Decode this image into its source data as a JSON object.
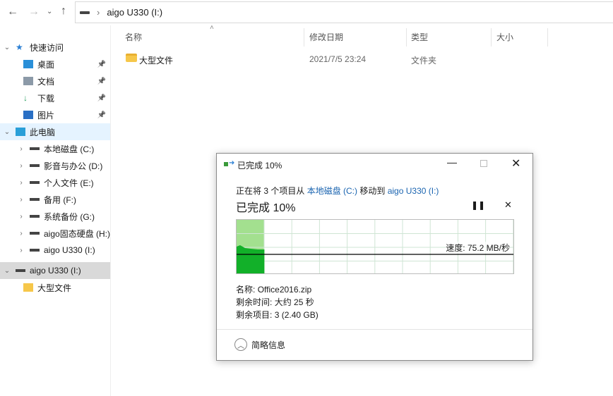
{
  "address": {
    "path": "aigo U330 (I:)"
  },
  "sidebar": {
    "items": [
      {
        "label": "快速访问",
        "icon": "star-icon"
      },
      {
        "label": "桌面",
        "icon": "desktop-icon",
        "pinned": true
      },
      {
        "label": "文档",
        "icon": "document-icon",
        "pinned": true
      },
      {
        "label": "下载",
        "icon": "download-icon",
        "pinned": true
      },
      {
        "label": "图片",
        "icon": "pictures-icon",
        "pinned": true
      },
      {
        "label": "此电脑",
        "icon": "computer-icon"
      },
      {
        "label": "本地磁盘 (C:)",
        "icon": "drive-icon"
      },
      {
        "label": "影音与办公 (D:)",
        "icon": "drive-icon"
      },
      {
        "label": "个人文件 (E:)",
        "icon": "drive-icon"
      },
      {
        "label": "备用 (F:)",
        "icon": "drive-icon"
      },
      {
        "label": "系统备份 (G:)",
        "icon": "drive-icon"
      },
      {
        "label": "aigo固态硬盘 (H:)",
        "icon": "drive-icon"
      },
      {
        "label": "aigo U330 (I:)",
        "icon": "drive-icon"
      },
      {
        "label": "aigo U330 (I:)",
        "icon": "drive-icon"
      },
      {
        "label": "大型文件",
        "icon": "folder-icon"
      }
    ]
  },
  "columns": {
    "name": "名称",
    "date": "修改日期",
    "type": "类型",
    "size": "大小"
  },
  "files": [
    {
      "name": "大型文件",
      "date": "2021/7/5 23:24",
      "type": "文件夹",
      "size": ""
    }
  ],
  "dialog": {
    "title": "已完成 10%",
    "line_prefix": "正在将 3 个项目从",
    "source": "本地磁盘 (C:)",
    "line_mid": "移动到",
    "dest": "aigo U330 (I:)",
    "heading": "已完成 10%",
    "progress_percent": 10,
    "speed": "速度: 75.2 MB/秒",
    "name_label": "名称:",
    "name_value": "Office2016.zip",
    "time_label": "剩余时间:",
    "time_value": "大约 25 秒",
    "items_label": "剩余项目:",
    "items_value": "3 (2.40 GB)",
    "less_details": "简略信息"
  }
}
